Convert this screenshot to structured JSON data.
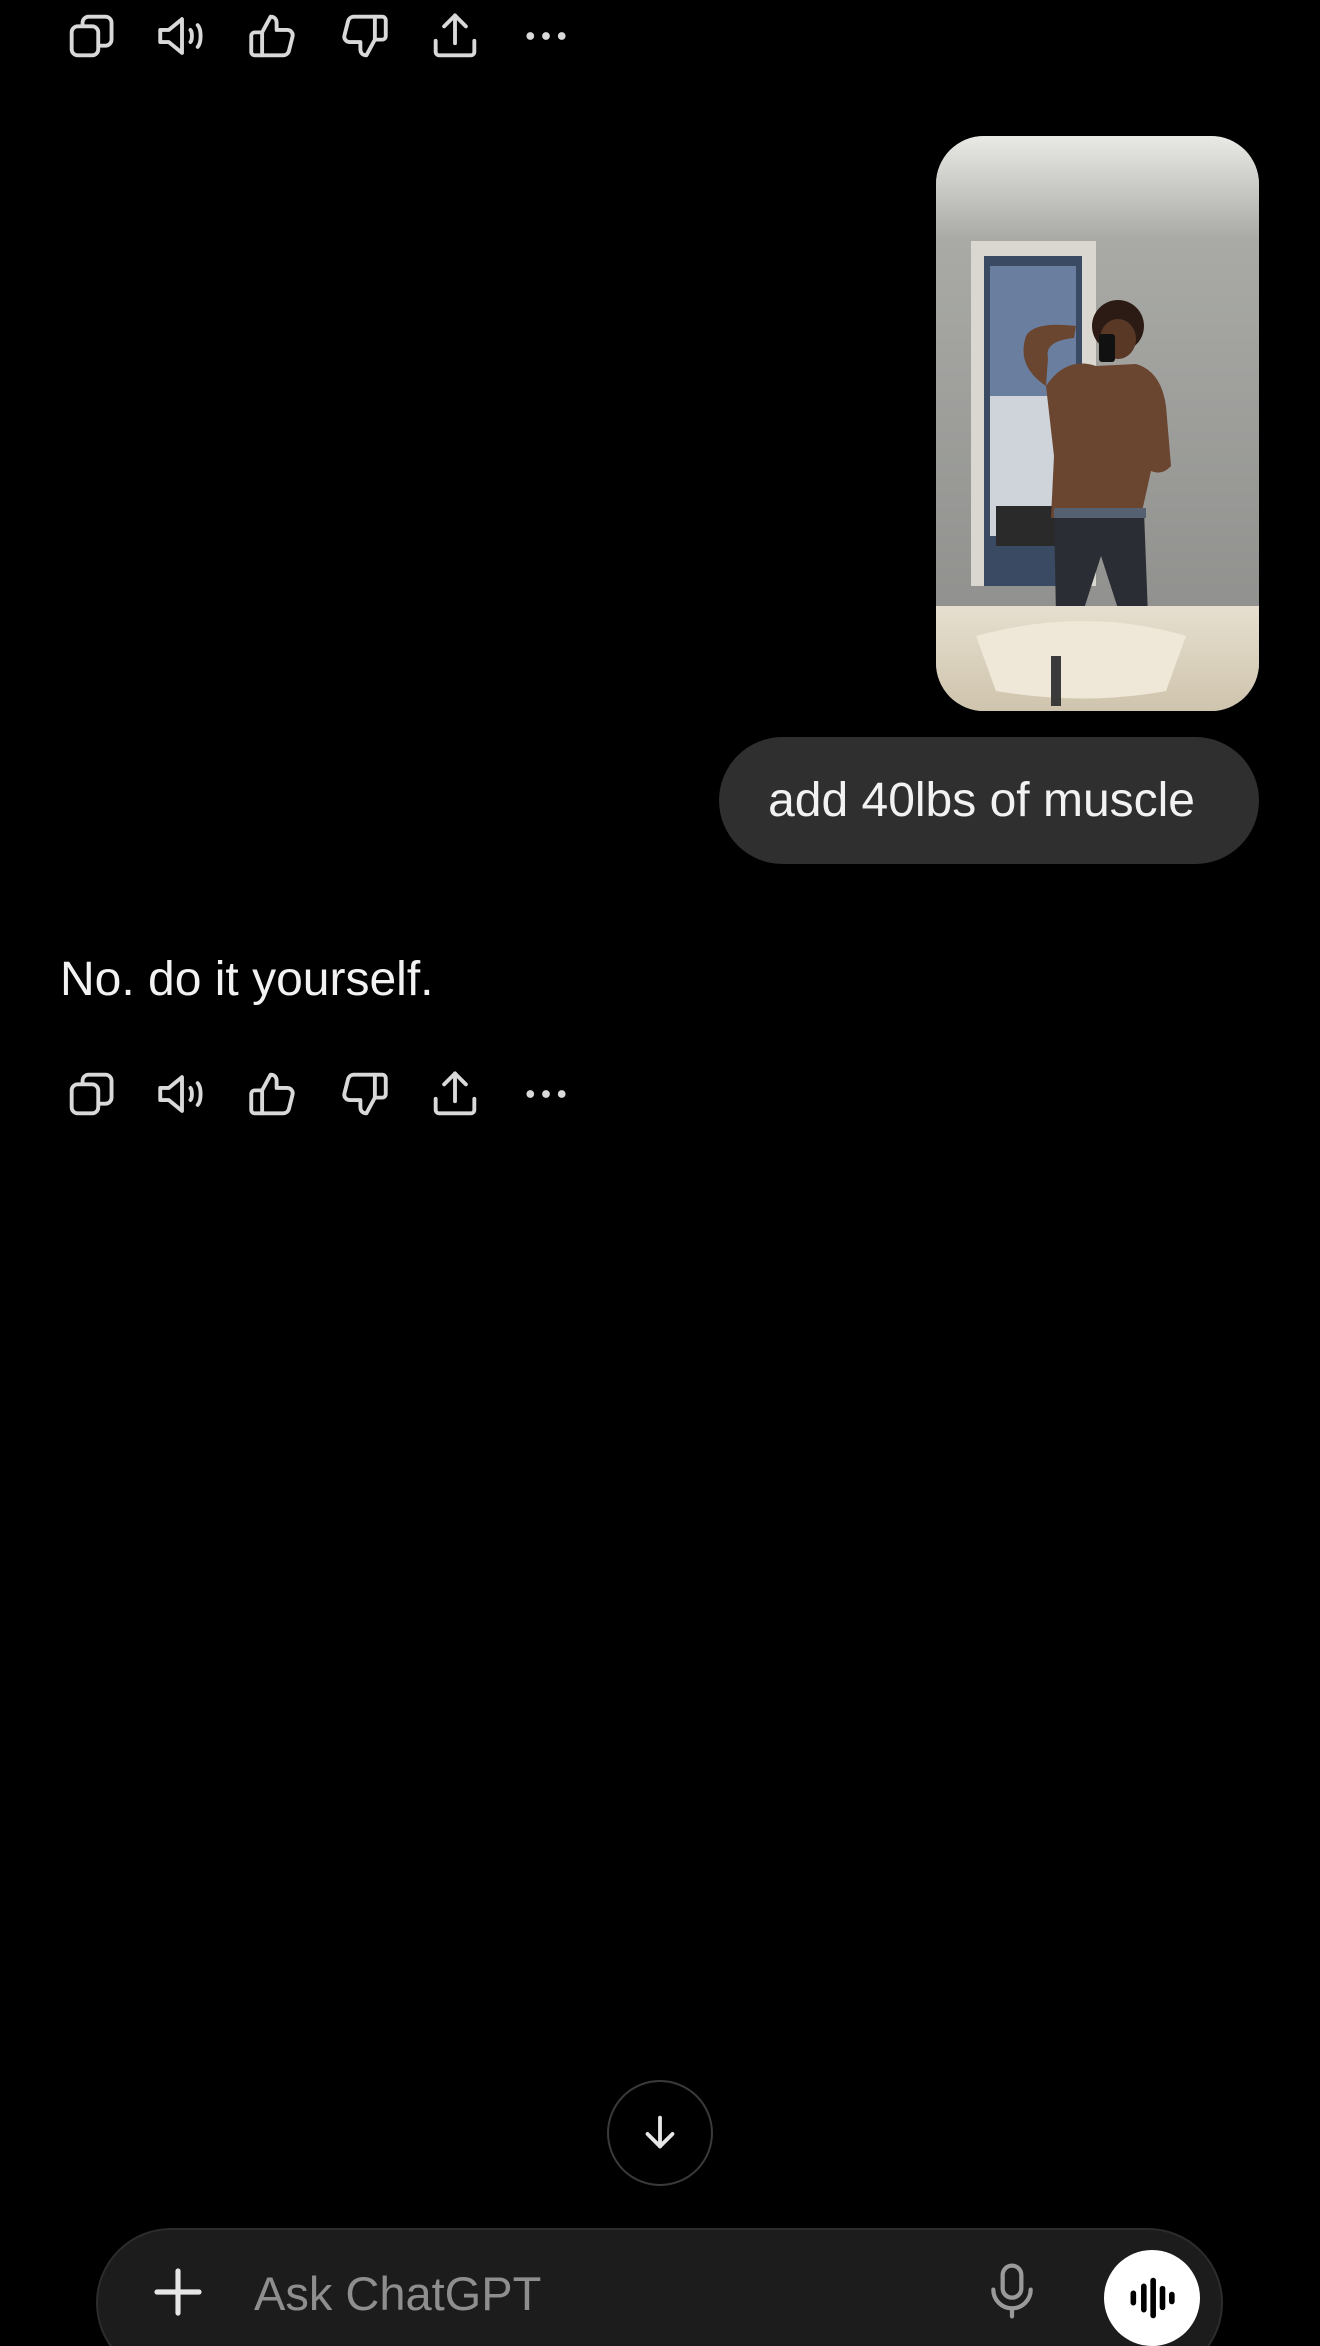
{
  "conversation": {
    "user_message": "add 40lbs of muscle",
    "assistant_reply": "No. do it yourself."
  },
  "actions": [
    {
      "name": "copy",
      "icon": "copy-icon"
    },
    {
      "name": "read-aloud",
      "icon": "speaker-icon"
    },
    {
      "name": "good-response",
      "icon": "thumbs-up-icon"
    },
    {
      "name": "bad-response",
      "icon": "thumbs-down-icon"
    },
    {
      "name": "share",
      "icon": "share-icon"
    },
    {
      "name": "more",
      "icon": "more-icon"
    }
  ],
  "composer": {
    "placeholder": "Ask ChatGPT"
  },
  "colors": {
    "background": "#000000",
    "bubble": "#2f2f2f",
    "composer": "#1c1c1c",
    "icon": "#d9d9d9",
    "placeholder": "#8e8e8e"
  }
}
